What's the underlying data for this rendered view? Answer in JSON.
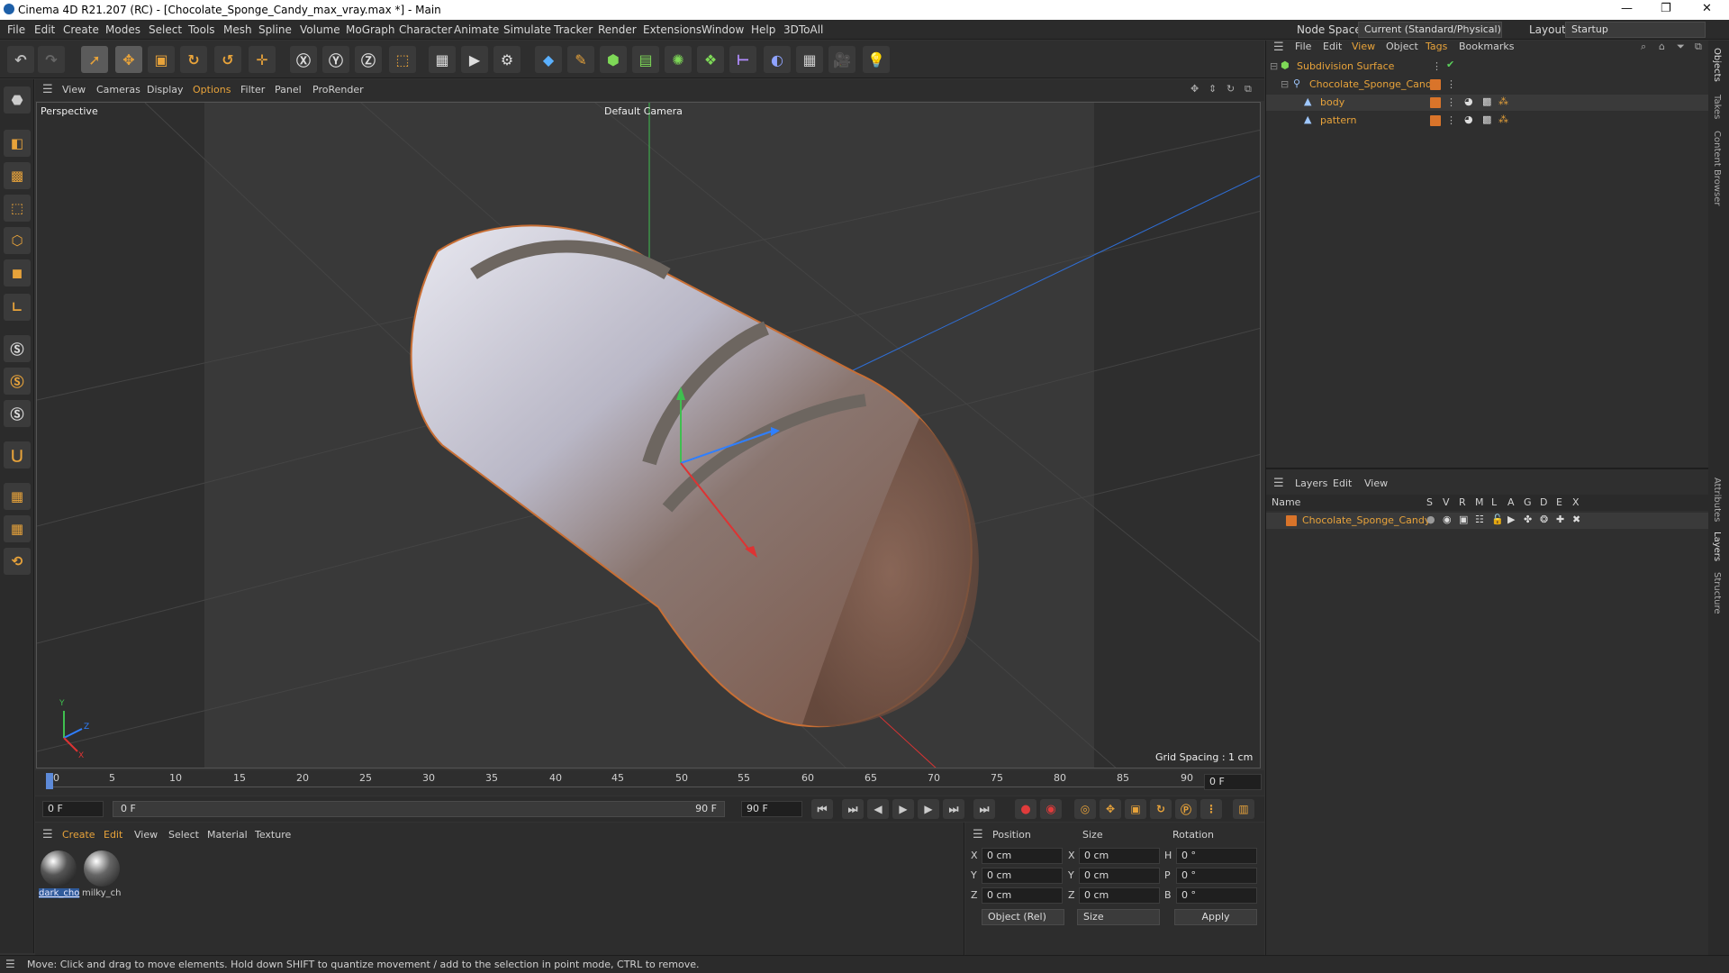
{
  "window": {
    "title": "Cinema 4D R21.207 (RC) - [Chocolate_Sponge_Candy_max_vray.max *] - Main",
    "minimize": "—",
    "maximize": "❐",
    "close": "✕"
  },
  "menu": [
    "File",
    "Edit",
    "Create",
    "Modes",
    "Select",
    "Tools",
    "Mesh",
    "Spline",
    "Volume",
    "MoGraph",
    "Character",
    "Animate",
    "Simulate",
    "Tracker",
    "Render",
    "Extensions",
    "Window",
    "Help",
    "3DToAll"
  ],
  "header_right": {
    "node_space_label": "Node Space:",
    "node_space_value": "Current (Standard/Physical)",
    "layout_label": "Layout:",
    "layout_value": "Startup"
  },
  "viewport": {
    "menu": [
      "View",
      "Cameras",
      "Display",
      "Options",
      "Filter",
      "Panel",
      "ProRender"
    ],
    "label": "Perspective",
    "camera": "Default Camera",
    "grid_spacing": "Grid Spacing : 1 cm",
    "axis_y": "Y",
    "axis_z": "Z",
    "axis_x": "X"
  },
  "timeline": {
    "ticks": [
      "0",
      "5",
      "10",
      "15",
      "20",
      "25",
      "30",
      "35",
      "40",
      "45",
      "50",
      "55",
      "60",
      "65",
      "70",
      "75",
      "80",
      "85",
      "90"
    ],
    "current_frame": "0 F",
    "start_field": "0 F",
    "range_start": "0 F",
    "range_end": "90 F",
    "end_field": "90 F"
  },
  "materials": {
    "menu": [
      "Create",
      "Edit",
      "View",
      "Select",
      "Material",
      "Texture"
    ],
    "items": [
      {
        "name": "dark_cho"
      },
      {
        "name": "milky_ch"
      }
    ]
  },
  "attributes": {
    "headers": {
      "position": "Position",
      "size": "Size",
      "rotation": "Rotation"
    },
    "rows": [
      {
        "axis": "X",
        "pos": "0 cm",
        "size_axis": "X",
        "size": "0 cm",
        "rot_axis": "H",
        "rot": "0 °"
      },
      {
        "axis": "Y",
        "pos": "0 cm",
        "size_axis": "Y",
        "size": "0 cm",
        "rot_axis": "P",
        "rot": "0 °"
      },
      {
        "axis": "Z",
        "pos": "0 cm",
        "size_axis": "Z",
        "size": "0 cm",
        "rot_axis": "B",
        "rot": "0 °"
      }
    ],
    "mode": "Object (Rel)",
    "size_mode": "Size",
    "apply": "Apply"
  },
  "objects_panel": {
    "menu": [
      "File",
      "Edit",
      "View",
      "Object",
      "Tags",
      "Bookmarks"
    ],
    "items": [
      {
        "name": "Subdivision Surface",
        "color": "#e8a33a"
      },
      {
        "name": "Chocolate_Sponge_Candy",
        "color": "#e8a33a"
      },
      {
        "name": "body",
        "color": "#e8a33a"
      },
      {
        "name": "pattern",
        "color": "#e8a33a"
      }
    ]
  },
  "layers_panel": {
    "menu": [
      "Layers",
      "Edit",
      "View"
    ],
    "col_name": "Name",
    "flags": [
      "S",
      "V",
      "R",
      "M",
      "L",
      "A",
      "G",
      "D",
      "E",
      "X"
    ],
    "items": [
      {
        "name": "Chocolate_Sponge_Candy"
      }
    ]
  },
  "side_tabs": [
    "Objects",
    "Takes",
    "Content Browser",
    "Attributes",
    "Layers",
    "Structure"
  ],
  "status": "Move: Click and drag to move elements. Hold down SHIFT to quantize movement / add to the selection in point mode, CTRL to remove."
}
